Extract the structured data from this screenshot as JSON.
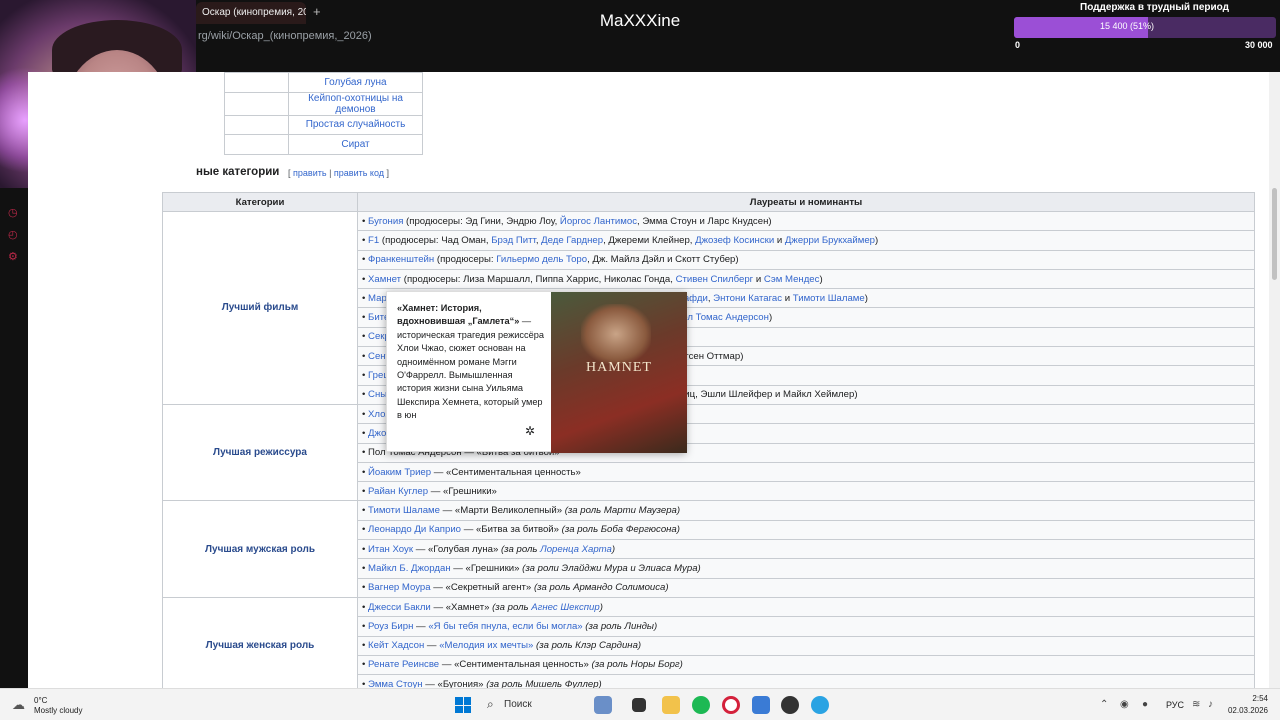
{
  "browser": {
    "tab_title": "Оскар (кинопремия, 2026",
    "tab_plus": "+",
    "url": "rg/wiki/Оскар_(кинопремия,_2026)"
  },
  "stream": {
    "title": "MaXXXine",
    "support_label": "Поддержка в трудный период",
    "support_value": "15 400 (51%)",
    "support_min": "0",
    "support_max": "30 000",
    "support_fraction": 0.51
  },
  "wiki": {
    "faded_text": "​",
    "small_table_rows": [
      "Голубая луна",
      "Кейпоп-охотницы на демонов",
      "Простая случайность",
      "Сират"
    ],
    "section_title": "ные категории",
    "section_edit_open": "[",
    "section_edit_1": "править",
    "section_edit_sep": "|",
    "section_edit_2": "править код",
    "section_edit_close": "]",
    "table_headers": {
      "category": "Категории",
      "nominees": "Лауреаты и номинанты"
    },
    "categories": {
      "best_picture": "Лучший фильм",
      "best_director": "Лучшая режиссура",
      "best_actor": "Лучшая мужская роль",
      "best_actress": "Лучшая женская роль"
    }
  },
  "popup": {
    "title": "«Хамнет: История, вдохновившая „Гамлета“»",
    "dash": " — ",
    "body": "историческая трагедия режиссёра Хлои Чжао, сюжет основан на одноимённом романе Мэгги О'Фаррелл. Вымышленная история жизни сына Уильяма Шекспира Хемнета, который умер в юн",
    "poster_title": "HAMNET"
  },
  "taskbar": {
    "temp": "0°C",
    "weather": "Mostly cloudy",
    "search": "Поиск",
    "lang": "РУС",
    "time": "2:54",
    "date": "02.03.2026"
  }
}
